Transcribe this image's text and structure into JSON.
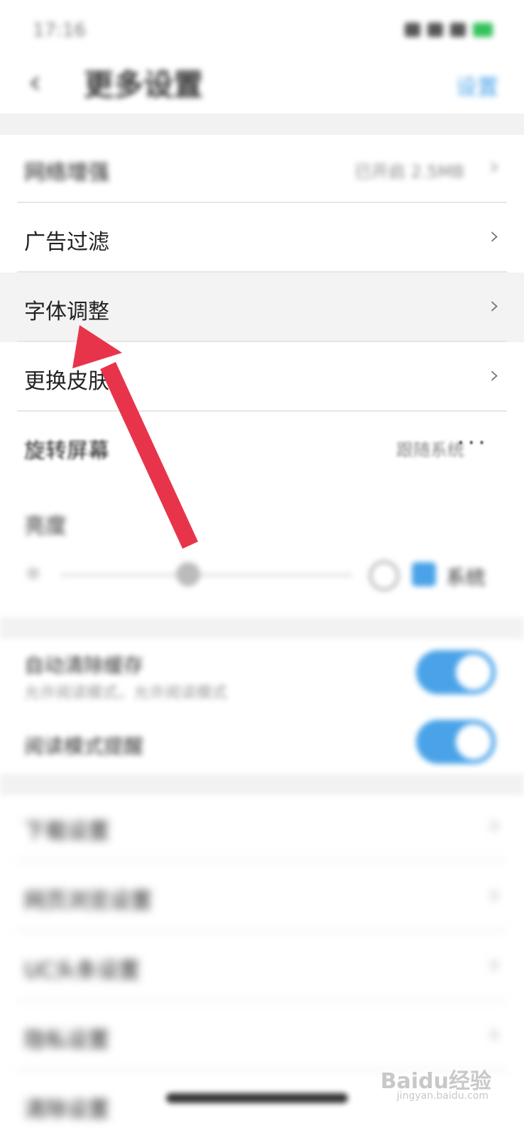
{
  "status_bar": {
    "time": "17:16"
  },
  "header": {
    "title": "更多设置",
    "action": "设置"
  },
  "rows": [
    {
      "label": "网络增强",
      "value": "已开启 2.5MB"
    },
    {
      "label": "广告过滤"
    },
    {
      "label": "字体调整"
    },
    {
      "label": "更换皮肤"
    },
    {
      "label": "旋转屏幕",
      "value": "跟随系统"
    }
  ],
  "brightness": {
    "label": "亮度",
    "auto_label": "系统"
  },
  "toggles": [
    {
      "title": "自动清除缓存",
      "subtitle": "允许阅读模式，允许阅读模式"
    },
    {
      "title": "阅读模式提醒"
    }
  ],
  "more_rows": [
    {
      "label": "下载设置"
    },
    {
      "label": "网页浏览设置"
    },
    {
      "label": "UC头条设置"
    },
    {
      "label": "隐私设置"
    },
    {
      "label": "清除设置"
    }
  ],
  "watermark": {
    "brand": "Baidu经验",
    "url": "jingyan.baidu.com"
  },
  "colors": {
    "accent": "#4aa3e8",
    "annotation_arrow": "#e8344a",
    "highlight_row": "#f3f3f3"
  }
}
